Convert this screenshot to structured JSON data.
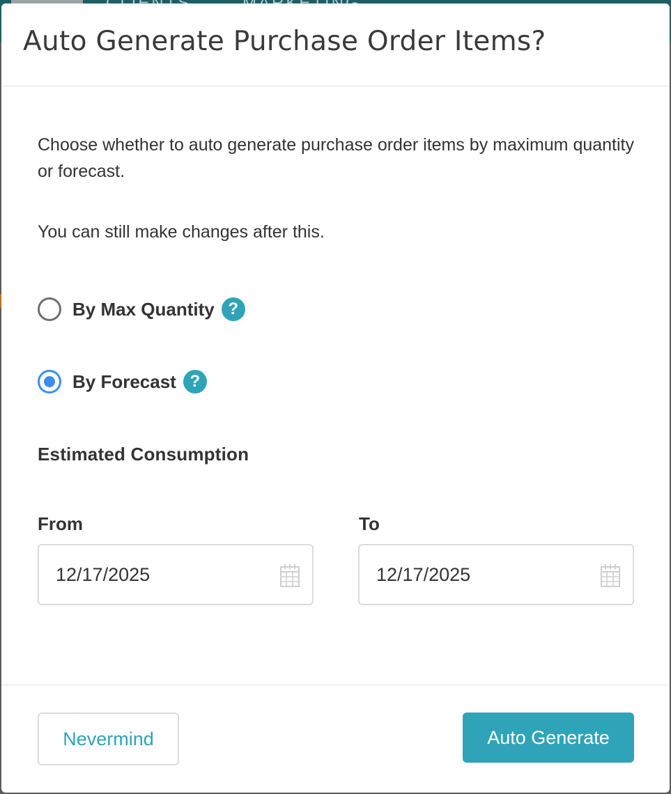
{
  "backdrop": {
    "nav_items": [
      "CLIENTS",
      "MARKETING"
    ]
  },
  "modal": {
    "title": "Auto Generate Purchase Order Items?",
    "description": "Choose whether to auto generate purchase order items by maximum quantity or forecast.",
    "note": "You can still make changes after this.",
    "options": [
      {
        "label": "By Max Quantity",
        "selected": false,
        "help_icon": "question-circle-icon"
      },
      {
        "label": "By Forecast",
        "selected": true,
        "help_icon": "question-circle-icon"
      }
    ],
    "help_glyph": "?",
    "estimated_consumption_label": "Estimated Consumption",
    "from": {
      "label": "From",
      "value": "12/17/2025",
      "icon": "calendar-icon"
    },
    "to": {
      "label": "To",
      "value": "12/17/2025",
      "icon": "calendar-icon"
    },
    "buttons": {
      "cancel": "Nevermind",
      "submit": "Auto Generate"
    }
  },
  "colors": {
    "accent": "#2fa4b8",
    "radio_selected": "#3b8ef0",
    "backdrop_header": "#1e5f66"
  }
}
